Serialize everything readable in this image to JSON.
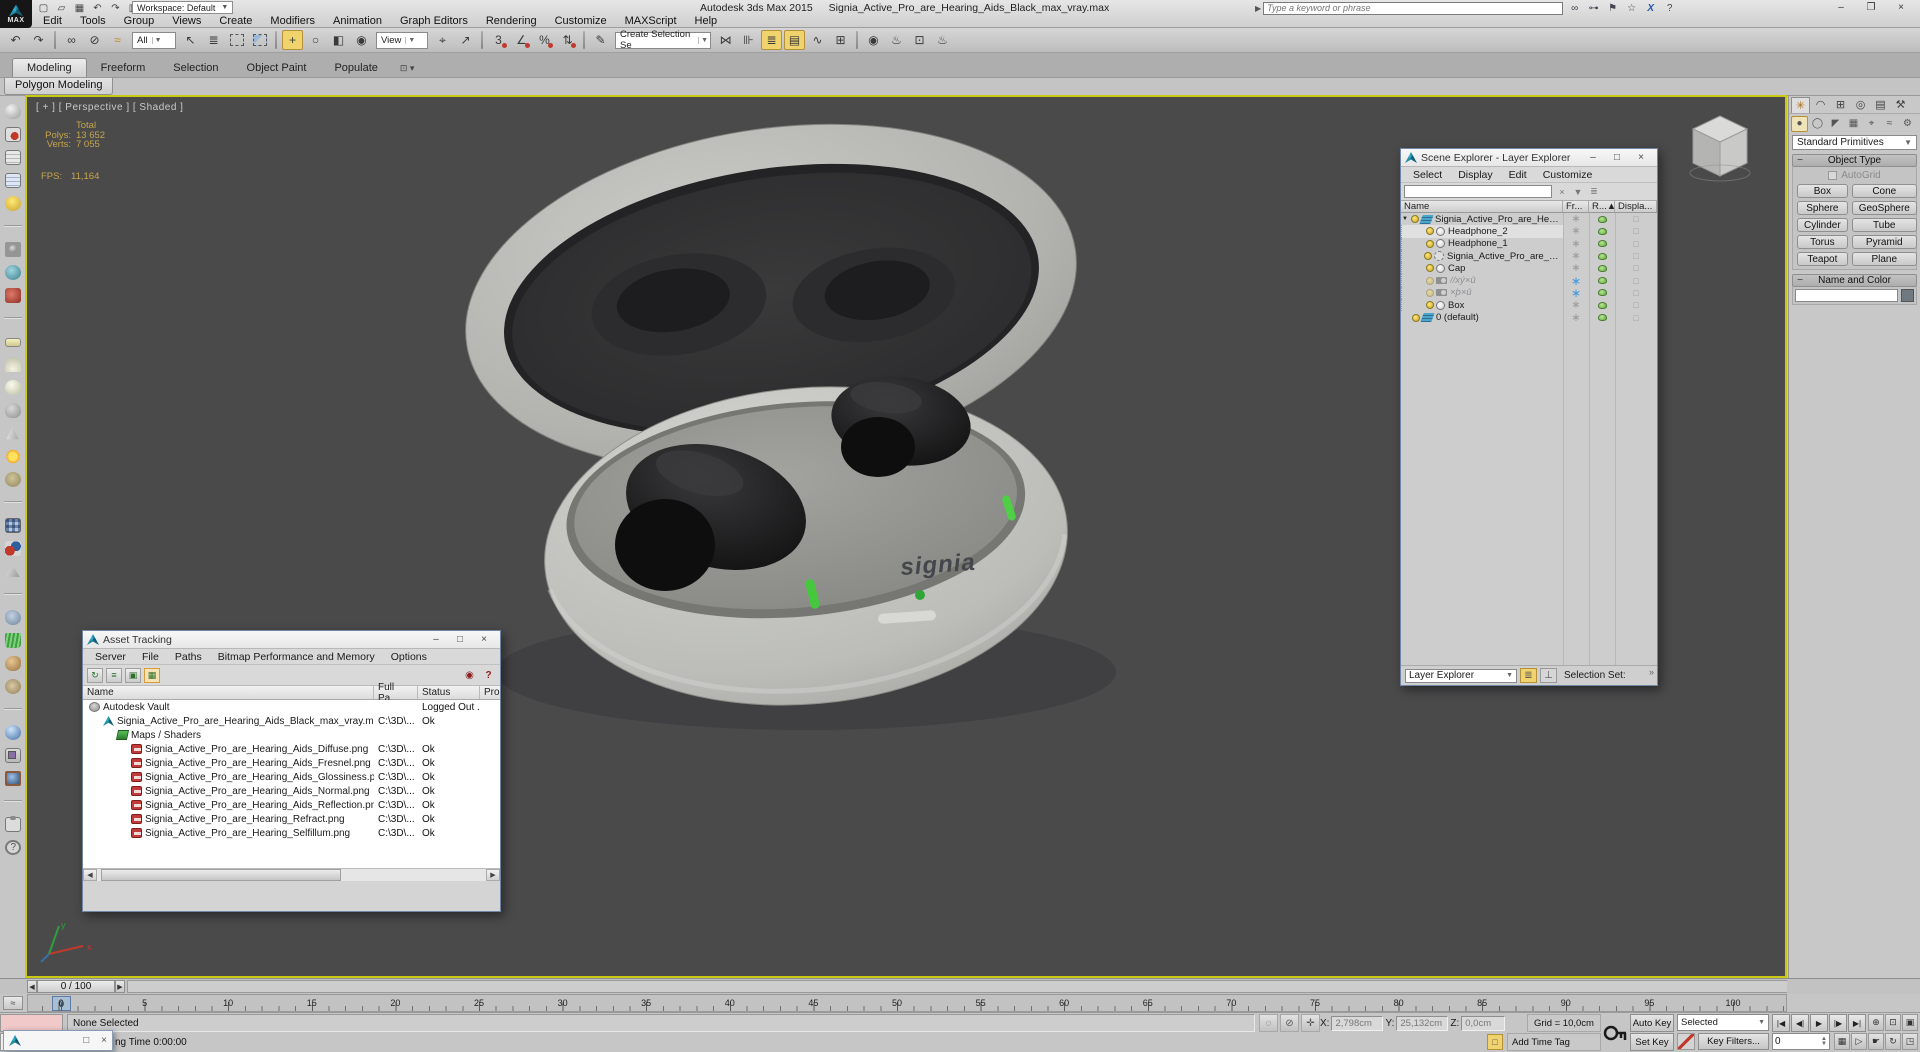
{
  "titlebar": {
    "app_label": "MAX",
    "title_app": "Autodesk 3ds Max 2015",
    "title_doc": "Signia_Active_Pro_are_Hearing_Aids_Black_max_vray.max",
    "workspace": "Workspace: Default",
    "search_placeholder": "Type a keyword or phrase",
    "qat_icons": [
      {
        "g": "▢",
        "name": "new-file-button"
      },
      {
        "g": "▱",
        "name": "open-file-button"
      },
      {
        "g": "▦",
        "name": "save-file-button"
      },
      {
        "g": "↶",
        "name": "undo-button"
      },
      {
        "g": "↷",
        "name": "redo-button"
      },
      {
        "g": "▥",
        "name": "project-folder-button"
      }
    ],
    "info_icons": [
      {
        "g": "∞",
        "cls": "",
        "name": "search-icon"
      },
      {
        "g": "⊶",
        "cls": "",
        "name": "subscription-key-icon"
      },
      {
        "g": "⚑",
        "cls": "",
        "name": "communication-center-icon"
      },
      {
        "g": "☆",
        "cls": "",
        "name": "favorites-icon"
      },
      {
        "g": "X",
        "cls": "blue",
        "name": "exchange-apps-icon"
      },
      {
        "g": "?",
        "cls": "",
        "name": "help-icon"
      }
    ],
    "win_buttons": [
      {
        "g": "–",
        "name": "minimize-button"
      },
      {
        "g": "❐",
        "name": "restore-button"
      },
      {
        "g": "×",
        "name": "close-button"
      }
    ]
  },
  "menubar": [
    "Edit",
    "Tools",
    "Group",
    "Views",
    "Create",
    "Modifiers",
    "Animation",
    "Graph Editors",
    "Rendering",
    "Customize",
    "MAXScript",
    "Help"
  ],
  "toolbar": {
    "filter": "All",
    "coord": "View",
    "selset": "Create Selection Se",
    "seg_a": [
      {
        "g": "↶",
        "cls": "",
        "name": "undo-scene-button"
      },
      {
        "g": "↷",
        "cls": "",
        "name": "redo-scene-button"
      },
      {
        "g": "",
        "cls": "divider",
        "name": "toolbar-divider"
      },
      {
        "g": "∞",
        "cls": "",
        "name": "select-and-link-button"
      },
      {
        "g": "⊘",
        "cls": "",
        "name": "unlink-selection-button"
      },
      {
        "g": "≈",
        "cls": "amber",
        "name": "bind-to-space-warp-button"
      }
    ],
    "seg_b": [
      {
        "g": "↖",
        "cls": "",
        "name": "select-object-button"
      },
      {
        "g": "≣",
        "cls": "",
        "name": "select-by-name-button"
      },
      {
        "g": "",
        "cls": "boxdash",
        "name": "rectangular-selection-region-button"
      },
      {
        "g": "",
        "cls": "boxfill",
        "name": "window-crossing-button"
      },
      {
        "g": "",
        "cls": "divider",
        "name": "toolbar-divider"
      },
      {
        "g": "+",
        "cls": "hl",
        "name": "select-and-move-button"
      },
      {
        "g": "○",
        "cls": "",
        "name": "select-and-rotate-button"
      },
      {
        "g": "◧",
        "cls": "",
        "name": "select-and-scale-button"
      },
      {
        "g": "◉",
        "cls": "",
        "name": "select-and-place-button"
      }
    ],
    "seg_c": [
      {
        "g": "⌖",
        "cls": "",
        "name": "use-pivot-center-button"
      },
      {
        "g": "↗",
        "cls": "",
        "name": "select-and-manipulate-button"
      },
      {
        "g": "",
        "cls": "divider",
        "name": "toolbar-divider"
      },
      {
        "g": "3",
        "cls": "snap",
        "name": "snaps-toggle-button"
      },
      {
        "g": "∠",
        "cls": "snap",
        "name": "angle-snap-button"
      },
      {
        "g": "%",
        "cls": "snap",
        "name": "percent-snap-button"
      },
      {
        "g": "⇅",
        "cls": "snap",
        "name": "spinner-snap-button"
      },
      {
        "g": "",
        "cls": "divider",
        "name": "toolbar-divider"
      },
      {
        "g": "✎",
        "cls": "",
        "name": "edit-named-selection-sets-button"
      }
    ],
    "seg_d": [
      {
        "g": "⋈",
        "cls": "",
        "name": "mirror-button"
      },
      {
        "g": "⊪",
        "cls": "",
        "name": "align-button"
      },
      {
        "g": "≣",
        "cls": "hl",
        "name": "manage-layers-button"
      },
      {
        "g": "▤",
        "cls": "hl",
        "name": "toggle-scene-explorer-button"
      },
      {
        "g": "∿",
        "cls": "",
        "name": "curve-editor-button"
      },
      {
        "g": "⊞",
        "cls": "",
        "name": "schematic-view-button"
      },
      {
        "g": "",
        "cls": "divider",
        "name": "toolbar-divider"
      },
      {
        "g": "◉",
        "cls": "",
        "name": "material-editor-button"
      },
      {
        "g": "♨",
        "cls": "",
        "name": "render-setup-button"
      },
      {
        "g": "⊡",
        "cls": "",
        "name": "rendered-frame-window-button"
      },
      {
        "g": "♨",
        "cls": "",
        "name": "render-production-button"
      }
    ]
  },
  "ribbon": {
    "tabs": [
      {
        "label": "Modeling",
        "cls": "active",
        "name": "ribbon-tab-modeling"
      },
      {
        "label": "Freeform",
        "cls": "",
        "name": "ribbon-tab-freeform"
      },
      {
        "label": "Selection",
        "cls": "",
        "name": "ribbon-tab-selection"
      },
      {
        "label": "Object Paint",
        "cls": "",
        "name": "ribbon-tab-object-paint"
      },
      {
        "label": "Populate",
        "cls": "",
        "name": "ribbon-tab-populate"
      }
    ],
    "extra": "⊡ ▾",
    "panel_button": "Polygon Modeling"
  },
  "left_rail": [
    {
      "cls": "i-teapot",
      "name": "render-last-icon"
    },
    {
      "cls": "i-rendersetup",
      "name": "render-setup-icon"
    },
    {
      "cls": "i-dialog",
      "name": "render-dialog-icon"
    },
    {
      "cls": "i-dialog2",
      "name": "batch-render-icon"
    },
    {
      "cls": "i-bulb",
      "name": "light-lister-icon"
    },
    {
      "cls": "sep",
      "name": "rail-divider"
    },
    {
      "cls": "i-camera",
      "name": "camera-icon"
    },
    {
      "cls": "i-env",
      "name": "environment-icon"
    },
    {
      "cls": "i-vidcam",
      "name": "video-preview-icon"
    },
    {
      "cls": "sep",
      "name": "rail-divider"
    },
    {
      "cls": "i-plane",
      "name": "plane-primitive-icon"
    },
    {
      "cls": "i-dome",
      "name": "dome-primitive-icon"
    },
    {
      "cls": "i-sphere",
      "name": "sphere-primitive-icon"
    },
    {
      "cls": "i-teapot2",
      "name": "teapot-primitive-icon"
    },
    {
      "cls": "i-cone",
      "name": "cone-primitive-icon"
    },
    {
      "cls": "i-sun",
      "name": "sunlight-icon"
    },
    {
      "cls": "i-disc",
      "name": "ground-plane-icon"
    },
    {
      "cls": "sep",
      "name": "rail-divider"
    },
    {
      "cls": "i-grid",
      "name": "grid-array-icon"
    },
    {
      "cls": "i-mol",
      "name": "molecule-icon"
    },
    {
      "cls": "i-pyr",
      "name": "pyramid-icon"
    },
    {
      "cls": "sep",
      "name": "rail-divider"
    },
    {
      "cls": "i-rock",
      "name": "rock-object-icon"
    },
    {
      "cls": "i-grass",
      "name": "grass-object-icon"
    },
    {
      "cls": "i-fur",
      "name": "hair-fur-icon"
    },
    {
      "cls": "i-shell",
      "name": "shell-object-icon"
    },
    {
      "cls": "sep",
      "name": "rail-divider"
    },
    {
      "cls": "i-bsphere",
      "name": "blue-sphere-icon"
    },
    {
      "cls": "i-mat",
      "name": "material-override-icon"
    },
    {
      "cls": "i-fsphere",
      "name": "framed-sphere-icon"
    },
    {
      "cls": "sep",
      "name": "rail-divider"
    },
    {
      "cls": "i-clip",
      "name": "clipboard-icon"
    },
    {
      "cls": "i-help",
      "name": "rail-help-icon"
    }
  ],
  "viewport": {
    "label": "[ + ] [ Perspective ] [ Shaded ]",
    "stats_total_label": "Total",
    "stats_polys_label": "Polys:",
    "stats_polys": "13 652",
    "stats_verts_label": "Verts:",
    "stats_verts": "7 055",
    "fps_label": "FPS:",
    "fps_value": "11,164",
    "case_logo": "signia"
  },
  "scene_explorer": {
    "title": "Scene Explorer - Layer Explorer",
    "menus": [
      "Select",
      "Display",
      "Edit",
      "Customize"
    ],
    "search_icons": [
      {
        "g": "×",
        "name": "clear-search-icon"
      },
      {
        "g": "▼",
        "name": "filter-icon"
      },
      {
        "g": "≣",
        "name": "add-layer-icon"
      }
    ],
    "columns": [
      "Name",
      "Fr...",
      "R...▲",
      "Displa..."
    ],
    "rows": [
      {
        "name": "Signia_Active_Pro_are_Hearing...",
        "icon": "ic-layer",
        "cls": "lvl0",
        "exp": "▼",
        "fr": ""
      },
      {
        "name": "Headphone_2",
        "icon": "ic-sphere",
        "cls": "lvl1 selected",
        "exp": "",
        "fr": ""
      },
      {
        "name": "Headphone_1",
        "icon": "ic-sphere",
        "cls": "lvl1",
        "exp": "",
        "fr": ""
      },
      {
        "name": "Signia_Active_Pro_are_Hea...",
        "icon": "ic-group",
        "cls": "lvl1",
        "exp": "",
        "fr": ""
      },
      {
        "name": "Cap",
        "icon": "ic-sphere",
        "cls": "lvl1",
        "exp": "",
        "fr": ""
      },
      {
        "name": "//xý×û",
        "icon": "ic-camera",
        "cls": "lvl1 frozen",
        "exp": "",
        "fr": "blue"
      },
      {
        "name": "×þ×û",
        "icon": "ic-camera",
        "cls": "lvl1 frozen",
        "exp": "",
        "fr": "blue"
      },
      {
        "name": "Box",
        "icon": "ic-sphere",
        "cls": "lvl1",
        "exp": "",
        "fr": ""
      },
      {
        "name": "0 (default)",
        "icon": "ic-layer",
        "cls": "lvl0",
        "exp": "",
        "fr": ""
      }
    ],
    "footer": {
      "mode": "Layer Explorer",
      "selection_label": "Selection Set:",
      "chevron": "»"
    }
  },
  "asset_tracking": {
    "title": "Asset Tracking",
    "menus": [
      "Server",
      "File",
      "Paths",
      "Bitmap Performance and Memory",
      "Options"
    ],
    "toolbar_icons": [
      {
        "g": "↻",
        "cls": "",
        "name": "refresh-icon"
      },
      {
        "g": "≡",
        "cls": "",
        "name": "list-view-icon"
      },
      {
        "g": "▣",
        "cls": "",
        "name": "thumbnail-view-icon"
      },
      {
        "g": "▦",
        "cls": "active",
        "name": "table-view-icon"
      }
    ],
    "right_icons": [
      {
        "g": "◉",
        "name": "vault-status-icon"
      },
      {
        "g": "?",
        "name": "asset-help-icon"
      }
    ],
    "columns": [
      "Name",
      "Full Pa...",
      "Status",
      "Pro"
    ],
    "rows": [
      {
        "name": "Autodesk Vault",
        "icon": "ic-vault",
        "cls": "lvl0",
        "path": "",
        "status": "Logged Out ..."
      },
      {
        "name": "Signia_Active_Pro_are_Hearing_Aids_Black_max_vray.max",
        "icon": "ic-max",
        "cls": "lvl1",
        "path": "C:\\3D\\...",
        "status": "Ok"
      },
      {
        "name": "Maps / Shaders",
        "icon": "ic-maps",
        "cls": "lvl2",
        "path": "",
        "status": ""
      },
      {
        "name": "Signia_Active_Pro_are_Hearing_Aids_Diffuse.png",
        "icon": "ic-png",
        "cls": "lvl3",
        "path": "C:\\3D\\...",
        "status": "Ok"
      },
      {
        "name": "Signia_Active_Pro_are_Hearing_Aids_Fresnel.png",
        "icon": "ic-png",
        "cls": "lvl3",
        "path": "C:\\3D\\...",
        "status": "Ok"
      },
      {
        "name": "Signia_Active_Pro_are_Hearing_Aids_Glossiness.png",
        "icon": "ic-png",
        "cls": "lvl3",
        "path": "C:\\3D\\...",
        "status": "Ok"
      },
      {
        "name": "Signia_Active_Pro_are_Hearing_Aids_Normal.png",
        "icon": "ic-png",
        "cls": "lvl3",
        "path": "C:\\3D\\...",
        "status": "Ok"
      },
      {
        "name": "Signia_Active_Pro_are_Hearing_Aids_Reflection.png",
        "icon": "ic-png",
        "cls": "lvl3",
        "path": "C:\\3D\\...",
        "status": "Ok"
      },
      {
        "name": "Signia_Active_Pro_are_Hearing_Refract.png",
        "icon": "ic-png",
        "cls": "lvl3",
        "path": "C:\\3D\\...",
        "status": "Ok"
      },
      {
        "name": "Signia_Active_Pro_are_Hearing_Selfillum.png",
        "icon": "ic-png",
        "cls": "lvl3",
        "path": "C:\\3D\\...",
        "status": "Ok"
      }
    ]
  },
  "command_panel": {
    "tabs": [
      {
        "g": "✳",
        "cls": "active",
        "name": "panel-tab-create"
      },
      {
        "g": "◠",
        "cls": "",
        "name": "panel-tab-modify"
      },
      {
        "g": "⊞",
        "cls": "",
        "name": "panel-tab-hierarchy"
      },
      {
        "g": "◎",
        "cls": "",
        "name": "panel-tab-motion"
      },
      {
        "g": "▤",
        "cls": "",
        "name": "panel-tab-display"
      },
      {
        "g": "⚒",
        "cls": "",
        "name": "panel-tab-utilities"
      }
    ],
    "subcats": [
      {
        "g": "●",
        "cls": "active",
        "name": "subtab-geometry"
      },
      {
        "g": "◯",
        "cls": "",
        "name": "subtab-shapes"
      },
      {
        "g": "◤",
        "cls": "",
        "name": "subtab-lights"
      },
      {
        "g": "▦",
        "cls": "",
        "name": "subtab-cameras"
      },
      {
        "g": "⌖",
        "cls": "",
        "name": "subtab-helpers"
      },
      {
        "g": "≈",
        "cls": "",
        "name": "subtab-space-warps"
      },
      {
        "g": "⚙",
        "cls": "",
        "name": "subtab-systems"
      }
    ],
    "category": "Standard Primitives",
    "object_type": {
      "title": "Object Type",
      "autogrid": "AutoGrid",
      "buttons": [
        "Box",
        "Cone",
        "Sphere",
        "GeoSphere",
        "Cylinder",
        "Tube",
        "Torus",
        "Pyramid",
        "Teapot",
        "Plane"
      ]
    },
    "name_color": {
      "title": "Name and Color"
    }
  },
  "timeline": {
    "slider_label": "0 / 100",
    "current_frame": "0",
    "ticks": [
      "0",
      "5",
      "10",
      "15",
      "20",
      "25",
      "30",
      "35",
      "40",
      "45",
      "50",
      "55",
      "60",
      "65",
      "70",
      "75",
      "80",
      "85",
      "90",
      "95",
      "100"
    ]
  },
  "statusbar": {
    "selection": "None Selected",
    "prompt": "ng Time  0:00:00",
    "toggles": [
      {
        "g": "◌",
        "name": "isolate-selection-toggle"
      },
      {
        "g": "⊘",
        "name": "selection-lock-toggle"
      },
      {
        "g": "✛",
        "name": "absolute-offset-toggle"
      }
    ],
    "x_label": "X:",
    "x_value": "2,798cm",
    "y_label": "Y:",
    "y_value": "25,132cm",
    "z_label": "Z:",
    "z_value": "0,0cm",
    "grid_label": "Grid = 10,0cm",
    "add_time_tag": "Add Time Tag",
    "auto_key": "Auto Key",
    "set_key": "Set Key",
    "key_mode": "Selected",
    "key_filters": "Key Filters...",
    "frame_value": "0",
    "playback": [
      {
        "g": "|◀",
        "name": "go-to-start-button"
      },
      {
        "g": "◀|",
        "name": "previous-frame-button"
      },
      {
        "g": "▶",
        "name": "play-animation-button"
      },
      {
        "g": "|▶",
        "name": "next-frame-button"
      },
      {
        "g": "▶|",
        "name": "go-to-end-button"
      }
    ],
    "nav_top": [
      {
        "g": "⊕",
        "name": "zoom-button"
      },
      {
        "g": "⊡",
        "name": "zoom-all-button"
      },
      {
        "g": "▣",
        "name": "zoom-extents-button"
      }
    ],
    "nav_bottom": [
      {
        "g": "▦",
        "name": "field-of-view-button"
      },
      {
        "g": "▷",
        "name": "zoom-region-button"
      },
      {
        "g": "☛",
        "name": "pan-view-button"
      },
      {
        "g": "↻",
        "name": "orbit-button"
      },
      {
        "g": "◳",
        "name": "maximize-viewport-toggle"
      }
    ]
  }
}
